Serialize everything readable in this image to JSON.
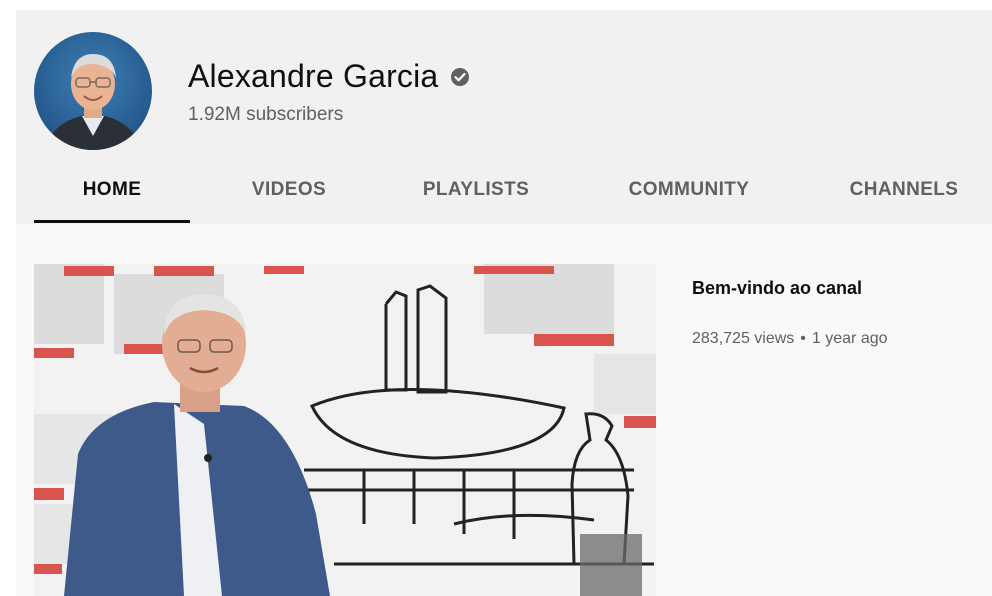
{
  "channel": {
    "name": "Alexandre Garcia",
    "subscribers": "1.92M subscribers",
    "verified": true,
    "avatar_icon": "avatar-photo-icon",
    "verified_icon": "verified-checkmark-icon"
  },
  "tabs": [
    {
      "label": "HOME",
      "active": true
    },
    {
      "label": "VIDEOS",
      "active": false
    },
    {
      "label": "PLAYLISTS",
      "active": false
    },
    {
      "label": "COMMUNITY",
      "active": false
    },
    {
      "label": "CHANNELS",
      "active": false
    }
  ],
  "featured_video": {
    "title": "Bem-vindo ao canal",
    "views": "283,725 views",
    "age": "1 year ago"
  },
  "colors": {
    "header_bg": "#f1f1f1",
    "text_primary": "#0f0f0f",
    "text_secondary": "#606060",
    "accent_red": "#d9534f"
  }
}
